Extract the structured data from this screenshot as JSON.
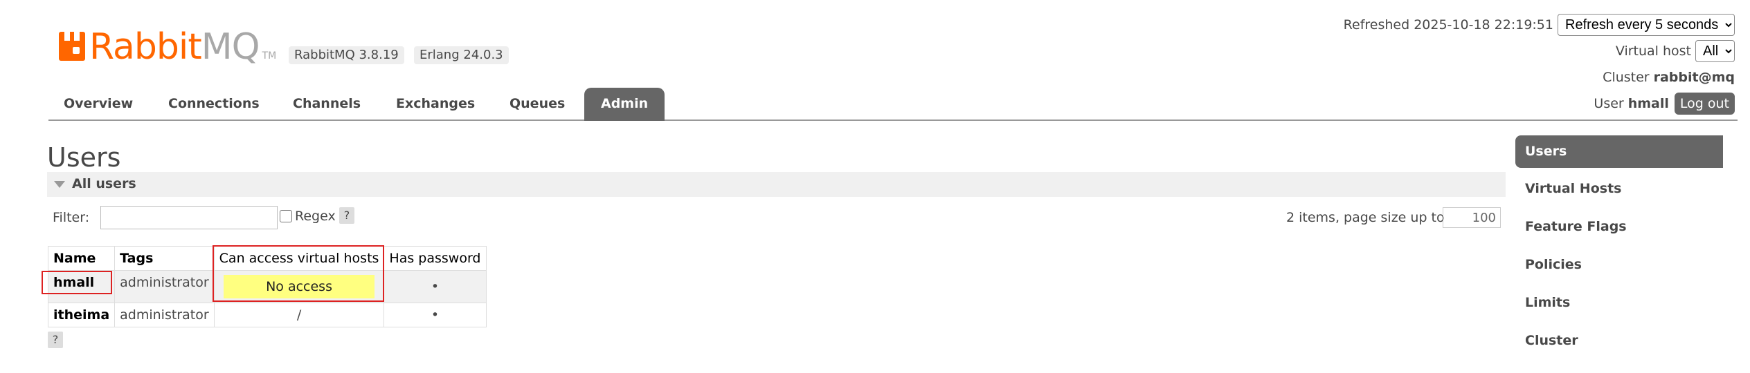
{
  "header": {
    "logo_text_rabbit": "Rabbit",
    "logo_text_mq": "MQ",
    "logo_tm": "TM",
    "rabbitmq_version": "RabbitMQ 3.8.19",
    "erlang_version": "Erlang 24.0.3",
    "refreshed_text": "Refreshed 2025-10-18 22:19:51",
    "refresh_select": "Refresh every 5 seconds",
    "virtual_host_label": "Virtual host",
    "virtual_host_value": "All",
    "cluster_label": "Cluster",
    "cluster_value": "rabbit@mq",
    "user_label": "User",
    "user_value": "hmall",
    "logout_label": "Log out"
  },
  "tabs": [
    {
      "label": "Overview"
    },
    {
      "label": "Connections"
    },
    {
      "label": "Channels"
    },
    {
      "label": "Exchanges"
    },
    {
      "label": "Queues"
    },
    {
      "label": "Admin",
      "active": true
    }
  ],
  "main": {
    "title": "Users",
    "section_label": "All users",
    "filter_label": "Filter:",
    "filter_value": "",
    "regex_label": "Regex",
    "help_glyph": "?",
    "page_size_label": "2 items, page size up to",
    "page_size_value": "100",
    "table": {
      "columns": [
        "Name",
        "Tags",
        "Can access virtual hosts",
        "Has password"
      ],
      "rows": [
        {
          "name": "hmall",
          "tags": "administrator",
          "vhosts": "No access",
          "has_password": "•"
        },
        {
          "name": "itheima",
          "tags": "administrator",
          "vhosts": "/",
          "has_password": "•"
        }
      ]
    }
  },
  "sidebar": {
    "items": [
      {
        "label": "Users",
        "active": true
      },
      {
        "label": "Virtual Hosts"
      },
      {
        "label": "Feature Flags"
      },
      {
        "label": "Policies"
      },
      {
        "label": "Limits"
      },
      {
        "label": "Cluster"
      }
    ]
  },
  "colors": {
    "brand_orange": "#ff6600",
    "tab_active_bg": "#666666",
    "no_access_bg": "#ffff80",
    "highlight_box": "#dd2222"
  }
}
